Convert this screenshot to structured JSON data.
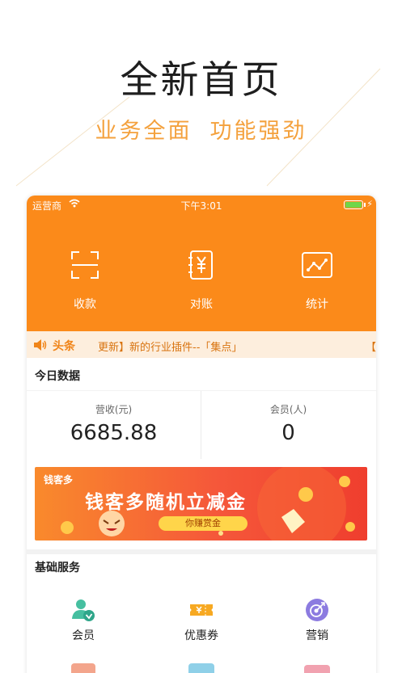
{
  "promo": {
    "title": "全新首页",
    "subtitle_left": "业务全面",
    "subtitle_right": "功能强劲"
  },
  "status_bar": {
    "carrier": "运营商",
    "time": "下午3:01",
    "battery_level": 1.0,
    "wifi_icon": "wifi-icon",
    "charging_icon": "lightning-icon"
  },
  "actions": [
    {
      "label": "收款",
      "icon": "scan-icon"
    },
    {
      "label": "对账",
      "icon": "yen-ledger-icon"
    },
    {
      "label": "统计",
      "icon": "line-chart-icon"
    }
  ],
  "news": {
    "icon": "speaker-icon",
    "heading": "头条",
    "text": "更新】新的行业插件--「集点」",
    "edge": "【"
  },
  "today": {
    "title": "今日数据",
    "revenue_label": "营收(元)",
    "revenue_value": "6685.88",
    "members_label": "会员(人)",
    "members_value": "0"
  },
  "banner": {
    "logo": "钱客多",
    "title": "钱客多随机立减金",
    "button": "你赚赏金"
  },
  "basic_services": {
    "title": "基础服务",
    "items": [
      {
        "label": "会员",
        "icon": "member-icon"
      },
      {
        "label": "优惠券",
        "icon": "coupon-icon"
      },
      {
        "label": "营销",
        "icon": "marketing-icon"
      }
    ]
  },
  "colors": {
    "accent": "#fb8a1a",
    "promo_sub": "#f4a13d",
    "news_bg": "#fdeedd"
  }
}
